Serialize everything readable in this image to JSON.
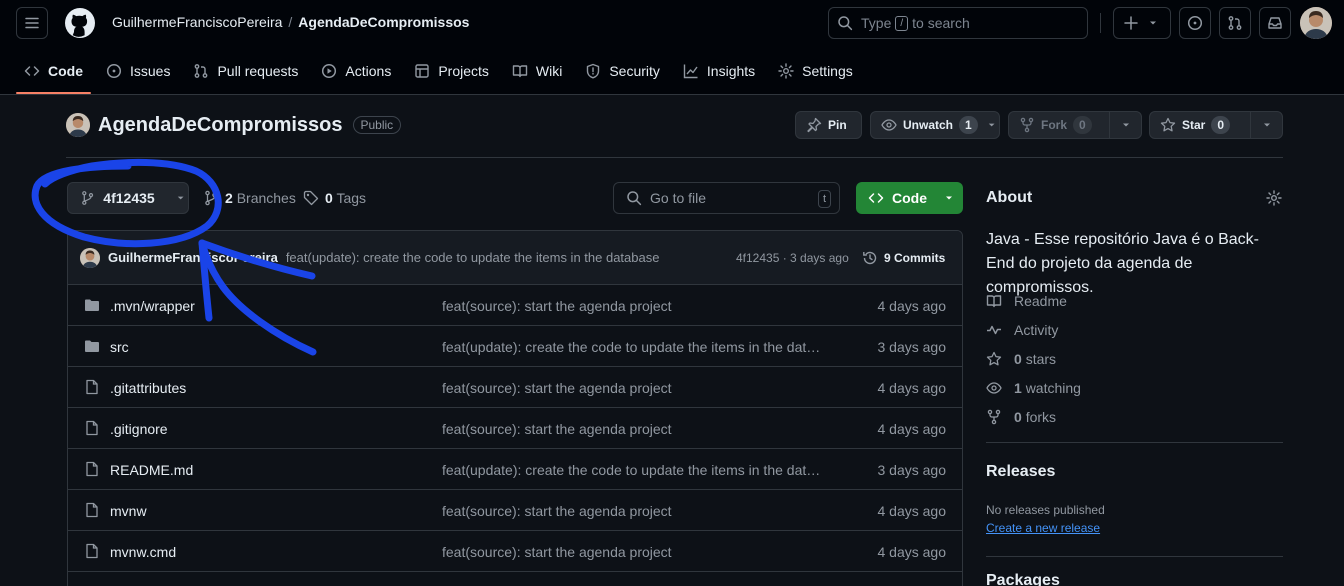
{
  "header": {
    "owner": "GuilhermeFranciscoPereira",
    "separator": "/",
    "repo": "AgendaDeCompromissos",
    "search": {
      "prefix": "Type",
      "key": "/",
      "suffix": "to search"
    }
  },
  "repo_nav": [
    {
      "label": "Code",
      "icon": "code-icon"
    },
    {
      "label": "Issues",
      "icon": "issue-icon"
    },
    {
      "label": "Pull requests",
      "icon": "pull-request-icon"
    },
    {
      "label": "Actions",
      "icon": "actions-icon"
    },
    {
      "label": "Projects",
      "icon": "projects-icon"
    },
    {
      "label": "Wiki",
      "icon": "book-icon"
    },
    {
      "label": "Security",
      "icon": "shield-icon"
    },
    {
      "label": "Insights",
      "icon": "graph-icon"
    },
    {
      "label": "Settings",
      "icon": "gear-icon"
    }
  ],
  "repo_head": {
    "name": "AgendaDeCompromissos",
    "visibility": "Public",
    "pin_label": "Pin",
    "unwatch_label": "Unwatch",
    "unwatch_count": "1",
    "fork_label": "Fork",
    "fork_count": "0",
    "star_label": "Star",
    "star_count": "0"
  },
  "toolbar": {
    "branch": "4f12435",
    "branches_count": "2",
    "branches_label": "Branches",
    "tags_count": "0",
    "tags_label": "Tags",
    "goto_placeholder": "Go to file",
    "goto_key": "t",
    "code_label": "Code"
  },
  "latest_commit": {
    "author": "GuilhermeFranciscoPereira",
    "message": "feat(update): create the code to update the items in the database",
    "sha_time": "4f12435 · 3 days ago",
    "commits_label": "9 Commits"
  },
  "files": [
    {
      "name": ".mvn/wrapper",
      "type": "folder",
      "message": "feat(source): start the agenda project",
      "date": "4 days ago"
    },
    {
      "name": "src",
      "type": "folder",
      "message": "feat(update): create the code to update the items in the data…",
      "date": "3 days ago"
    },
    {
      "name": ".gitattributes",
      "type": "file",
      "message": "feat(source): start the agenda project",
      "date": "4 days ago"
    },
    {
      "name": ".gitignore",
      "type": "file",
      "message": "feat(source): start the agenda project",
      "date": "4 days ago"
    },
    {
      "name": "README.md",
      "type": "file",
      "message": "feat(update): create the code to update the items in the data…",
      "date": "3 days ago"
    },
    {
      "name": "mvnw",
      "type": "file",
      "message": "feat(source): start the agenda project",
      "date": "4 days ago"
    },
    {
      "name": "mvnw.cmd",
      "type": "file",
      "message": "feat(source): start the agenda project",
      "date": "4 days ago"
    }
  ],
  "about": {
    "title": "About",
    "description": "Java - Esse repositório Java é o Back-End do projeto da agenda de compromissos.",
    "readme": "Readme",
    "activity": "Activity",
    "stars_count": "0",
    "stars_label": "stars",
    "watching_count": "1",
    "watching_label": "watching",
    "forks_count": "0",
    "forks_label": "forks"
  },
  "releases": {
    "title": "Releases",
    "none_text": "No releases published",
    "create_link": "Create a new release"
  },
  "packages": {
    "title": "Packages"
  },
  "annotation": {
    "color": "#1a44e8"
  }
}
